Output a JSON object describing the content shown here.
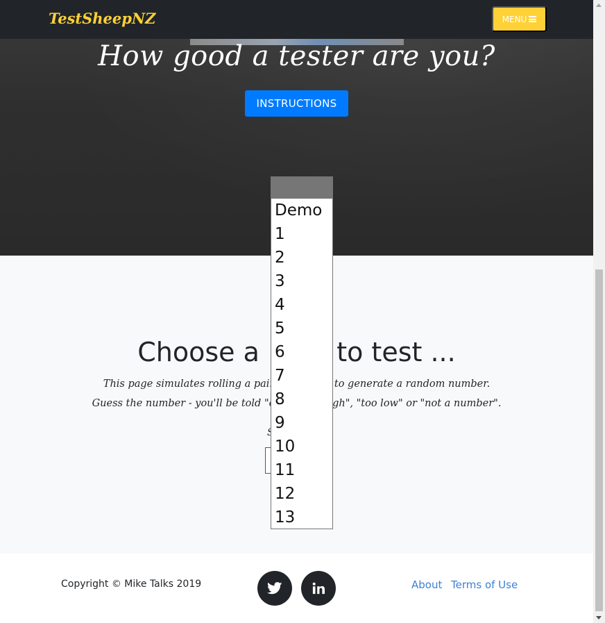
{
  "navbar": {
    "brand": "TestSheepNZ",
    "menu_label": "MENU",
    "menu_icon": "bars-icon",
    "brand_color": "#fed136",
    "background": "#212529"
  },
  "hero": {
    "title": "How good a tester are you?",
    "instructions_label": "INSTRUCTIONS",
    "button_color": "#007bff"
  },
  "content": {
    "heading": "Choose a ",
    "heading_tail": "d to test ...",
    "line1_left": "This page simulates rolling a pair o",
    "line1_right": "e to generate a random number.",
    "line2_left": "Guess the number - you'll be told \"co",
    "line2_right": "igh\", \"too low\" or \"not a number\".",
    "select_label": "S"
  },
  "dropdown": {
    "options": [
      "Demo",
      "1",
      "2",
      "3",
      "4",
      "5",
      "6",
      "7",
      "8",
      "9",
      "10",
      "11",
      "12",
      "13"
    ]
  },
  "footer": {
    "copyright": "Copyright © Mike Talks 2019",
    "social": [
      "twitter-icon",
      "linkedin-icon"
    ],
    "links": [
      "About",
      "Terms of Use"
    ],
    "link_color": "#3d7fd6"
  }
}
